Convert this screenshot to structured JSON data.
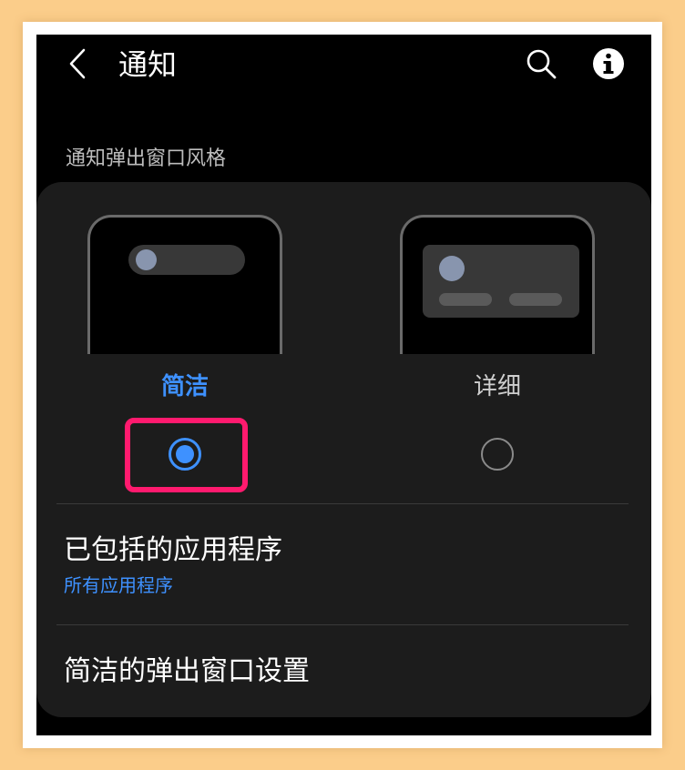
{
  "header": {
    "title": "通知",
    "back_icon": "chevron-left-icon",
    "search_icon": "search-icon",
    "info_icon": "info-icon"
  },
  "section": {
    "title": "通知弹出窗口风格"
  },
  "styles": {
    "options": [
      {
        "label": "简洁",
        "selected": true
      },
      {
        "label": "详细",
        "selected": false
      }
    ]
  },
  "rows": {
    "included_apps": {
      "title": "已包括的应用程序",
      "value": "所有应用程序"
    },
    "brief_settings": {
      "title": "简洁的弹出窗口设置"
    }
  },
  "colors": {
    "accent": "#3e91ff",
    "highlight": "#ff1a6e",
    "background": "#000000",
    "card": "#1c1c1c",
    "page_border": "#fbcd8a"
  }
}
